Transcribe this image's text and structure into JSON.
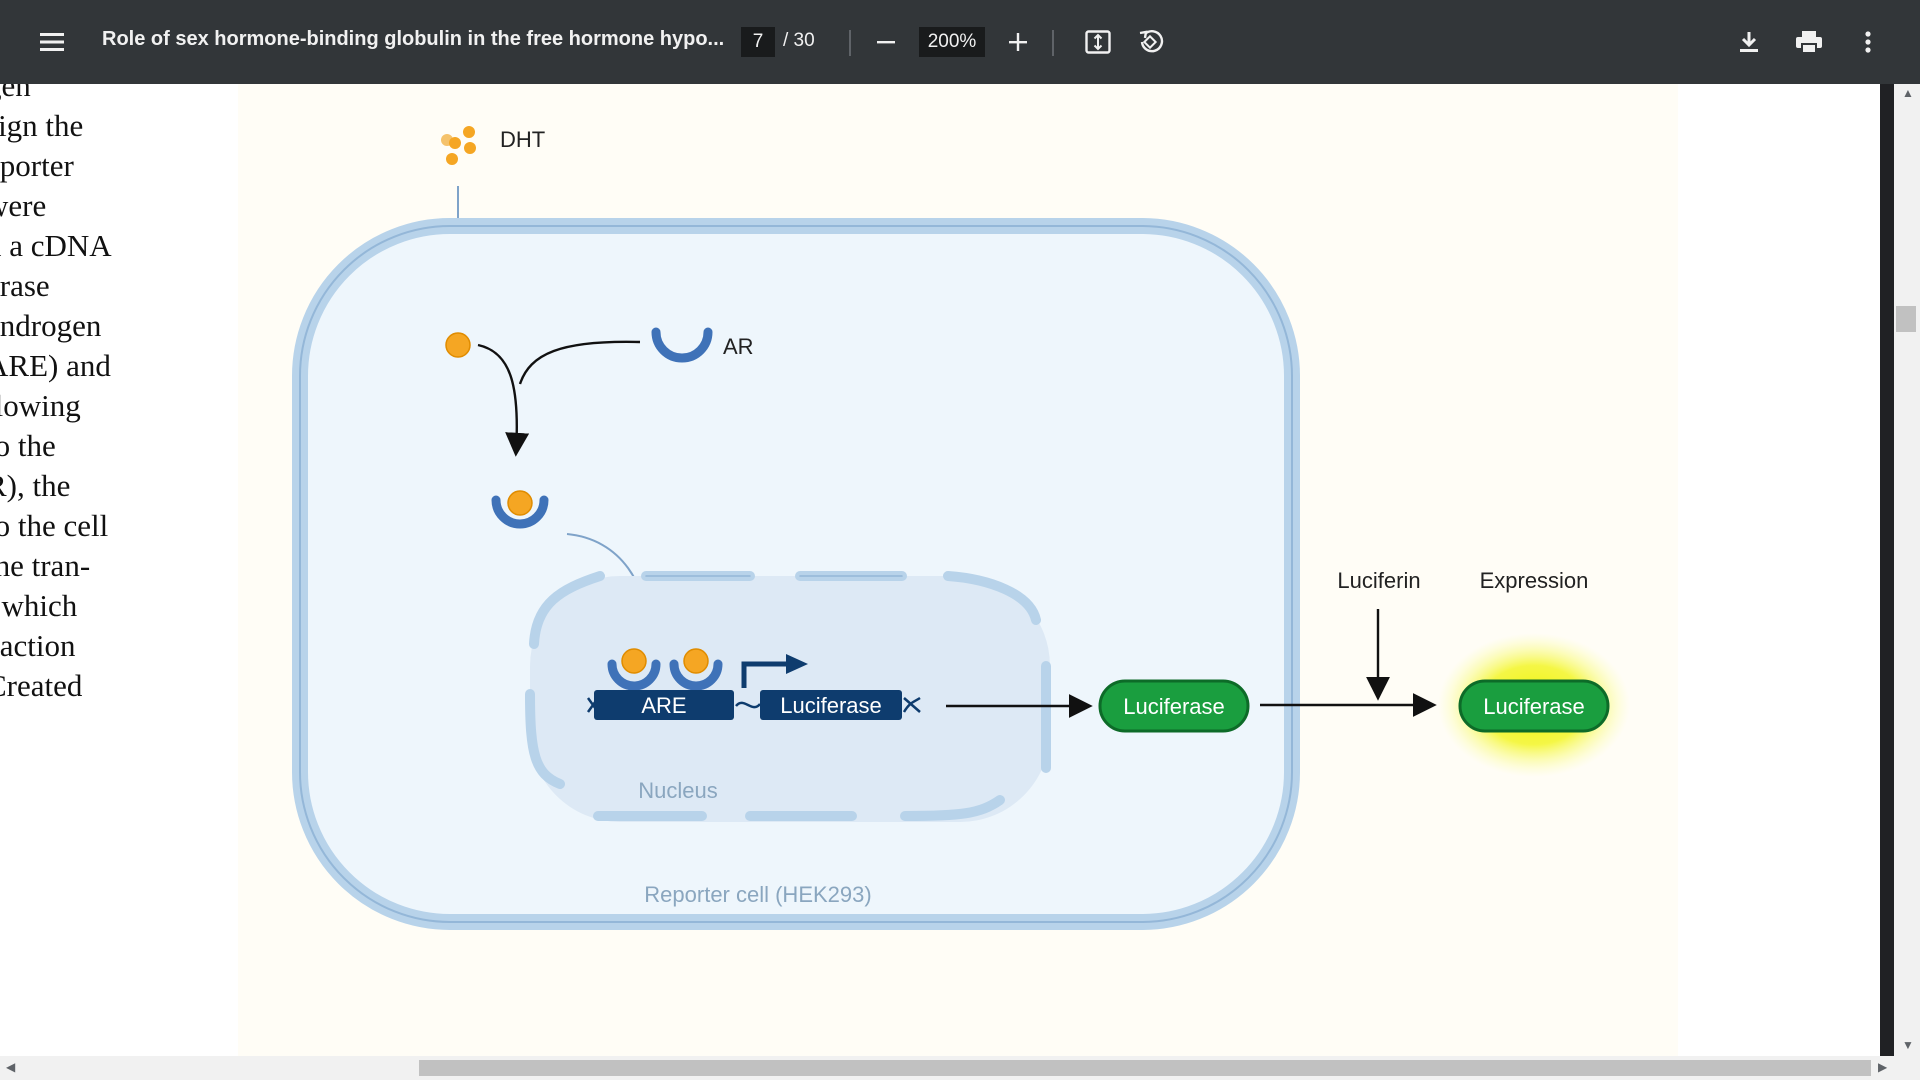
{
  "toolbar": {
    "title": "Role of sex hormone-binding globulin in the free hormone hypo...",
    "current_page": "7",
    "page_total": "/ 30",
    "zoom": "200%"
  },
  "body_text_lines": [
    "gen",
    "sign the",
    "eporter",
    " were",
    "n a cDNA",
    "erase",
    " androgen",
    "ARE) and",
    "llowing",
    " to the",
    "R), the",
    "to the cell",
    " the tran-",
    ", which",
    "eaction",
    " Created"
  ],
  "figure": {
    "dht_label": "DHT",
    "ar_label": "AR",
    "are_label": "ARE",
    "gene_label": "Luciferase",
    "nucleus_label": "Nucleus",
    "protein_label": "Luciferase",
    "luciferin_label": "Luciferin",
    "expression_label": "Expression",
    "expressed_label": "Luciferase",
    "cell_label": "Reporter cell (HEK293)"
  },
  "colors": {
    "toolbar_bg": "#323639",
    "hormone": "#f5a623",
    "receptor": "#3f72b8",
    "dna_box": "#0e3c6e",
    "luciferase_green": "#1a9e3f",
    "glow": "#eef200"
  }
}
